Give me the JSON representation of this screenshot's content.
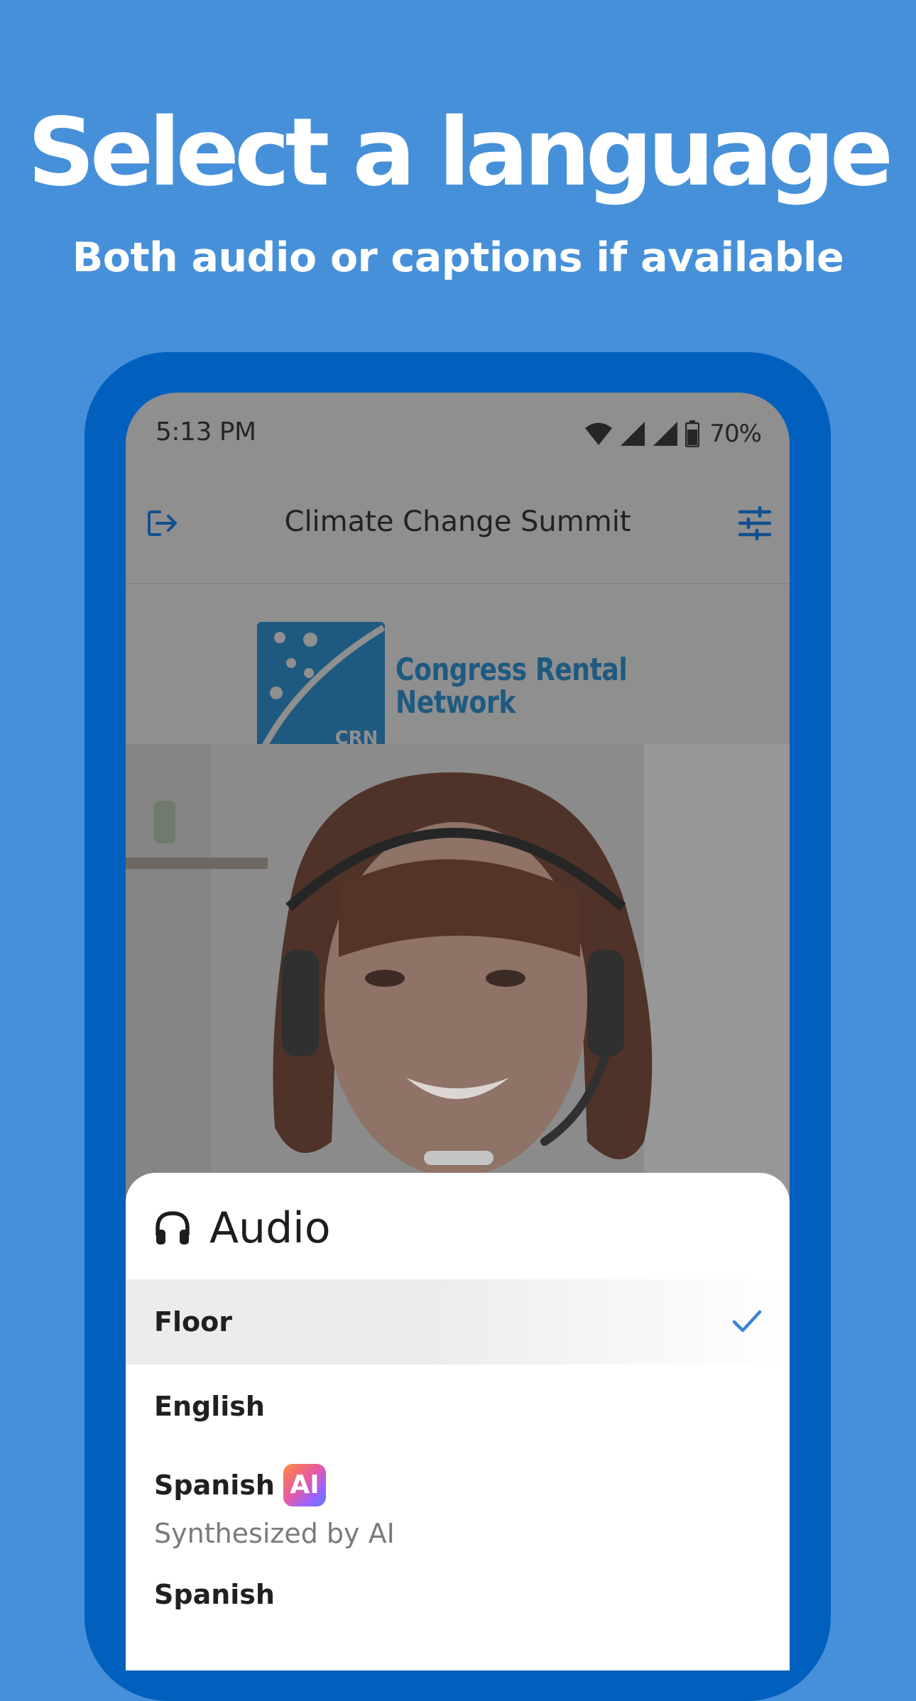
{
  "headline": "Select a language",
  "subheadline": "Both audio or captions if available",
  "status_bar": {
    "time": "5:13 PM",
    "battery": "70%"
  },
  "app_bar": {
    "title": "Climate Change Summit",
    "left_icon": "exit-icon",
    "right_icon": "tune-sliders-icon"
  },
  "logo": {
    "mark_text": "CRN",
    "line1": "Congress Rental",
    "line2": "Network"
  },
  "audio_sheet": {
    "icon": "headphones-icon",
    "title": "Audio",
    "options": [
      {
        "label": "Floor",
        "selected": true
      },
      {
        "label": "English",
        "selected": false
      },
      {
        "label": "Spanish",
        "badge": "AI",
        "sublabel": "Synthesized by AI",
        "selected": false
      },
      {
        "label": "Spanish",
        "selected": false
      }
    ]
  },
  "colors": {
    "background": "#4690d9",
    "phone_frame": "#0160bd",
    "accent": "#3b82d6",
    "logo_blue": "#1e5a80"
  }
}
